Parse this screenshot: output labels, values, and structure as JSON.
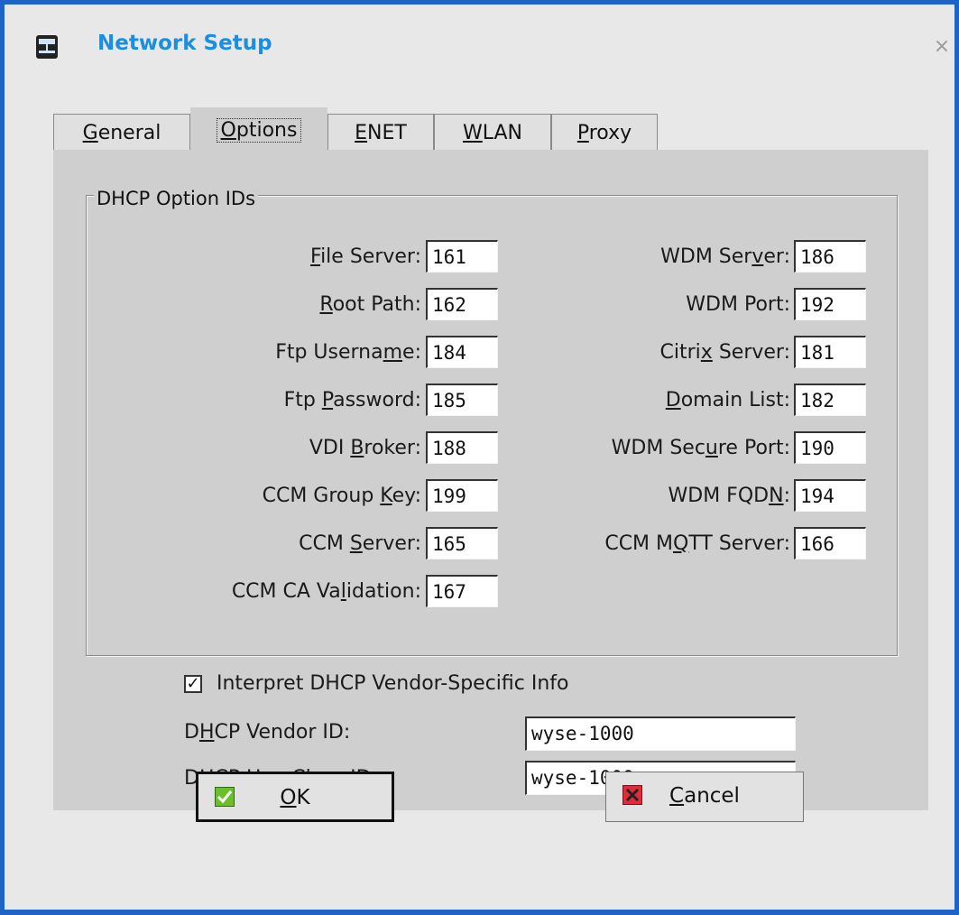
{
  "window": {
    "title": "Network Setup",
    "close_glyph": "×",
    "title_icon": "network-icon"
  },
  "tabs": [
    {
      "label": "General",
      "underline": "G",
      "active": false
    },
    {
      "label": "Options",
      "underline": "O",
      "active": true
    },
    {
      "label": "ENET",
      "underline": "E",
      "active": false
    },
    {
      "label": "WLAN",
      "underline": "W",
      "active": false
    },
    {
      "label": "Proxy",
      "underline": "P",
      "active": false
    }
  ],
  "group": {
    "title": "DHCP Option IDs"
  },
  "left_fields": [
    {
      "pre": "",
      "u": "F",
      "post": "ile Server:",
      "value": "161"
    },
    {
      "pre": "",
      "u": "R",
      "post": "oot Path:",
      "value": "162"
    },
    {
      "pre": "Ftp Userna",
      "u": "m",
      "post": "e:",
      "value": "184"
    },
    {
      "pre": "Ftp ",
      "u": "P",
      "post": "assword:",
      "value": "185"
    },
    {
      "pre": "VDI ",
      "u": "B",
      "post": "roker:",
      "value": "188"
    },
    {
      "pre": "CCM Group ",
      "u": "K",
      "post": "ey:",
      "value": "199"
    },
    {
      "pre": "CCM ",
      "u": "S",
      "post": "erver:",
      "value": "165"
    },
    {
      "pre": "CCM CA Va",
      "u": "l",
      "post": "idation:",
      "value": "167"
    }
  ],
  "right_fields": [
    {
      "pre": "WDM Ser",
      "u": "v",
      "post": "er:",
      "value": "186"
    },
    {
      "pre": "WDM Port:",
      "u": "",
      "post": "",
      "value": "192"
    },
    {
      "pre": "Citri",
      "u": "x",
      "post": " Server:",
      "value": "181"
    },
    {
      "pre": "",
      "u": "D",
      "post": "omain List:",
      "value": "182"
    },
    {
      "pre": "WDM Sec",
      "u": "u",
      "post": "re Port:",
      "value": "190"
    },
    {
      "pre": "WDM FQD",
      "u": "N",
      "post": ":",
      "value": "194"
    },
    {
      "pre": "CCM M",
      "u": "Q",
      "post": "TT Server:",
      "value": "166"
    }
  ],
  "vendor_specific": {
    "checked": true,
    "check_glyph": "✓",
    "label": "Interpret DHCP Vendor-Specific Info"
  },
  "vendor_id": {
    "pre": "D",
    "u": "H",
    "post": "CP Vendor ID:",
    "value": "wyse-1000"
  },
  "userclass_id": {
    "pre": "DHCP UserCl",
    "u": "a",
    "post": "ss ID:",
    "value": "wyse-1000"
  },
  "buttons": {
    "ok": {
      "u": "O",
      "post": "K",
      "icon": "check-icon",
      "icon_color": "#6abf2a"
    },
    "cancel": {
      "u": "C",
      "post": "ancel",
      "icon": "cross-icon",
      "icon_color": "#e22b3a"
    }
  },
  "colors": {
    "border": "#1e63c8",
    "title": "#1a8fe0",
    "panel": "#cfcfcf",
    "window": "#e8e8e8"
  }
}
